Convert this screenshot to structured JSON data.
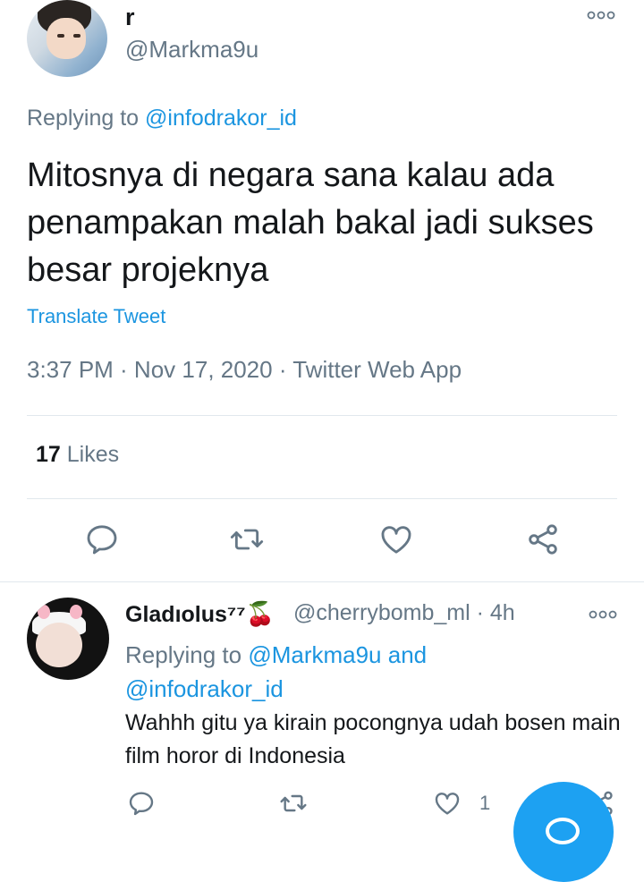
{
  "tweet": {
    "display_name": "r",
    "handle": "@Markma9u",
    "replying_prefix": "Replying to ",
    "replying_to": "@infodrakor_id",
    "text": "Mitosnya di negara sana kalau ada penampakan malah bakal jadi sukses besar projeknya",
    "translate_label": "Translate Tweet",
    "meta": "3:37 PM · Nov 17, 2020 · Twitter Web App",
    "likes_count": "17",
    "likes_label": "Likes"
  },
  "icons": {
    "more": "more-options-icon",
    "reply": "reply-icon",
    "retweet": "retweet-icon",
    "like": "heart-icon",
    "share": "share-icon",
    "compose": "compose-icon"
  },
  "reply": {
    "display_name": "Gladıolus⁷⁷",
    "emoji": "🍒",
    "handle_time": "@cherrybomb_ml · 4h",
    "replying_prefix": "Replying to ",
    "replying_user1": "@Markma9u",
    "replying_and": " and ",
    "replying_user2": "@infodrakor_id",
    "text": "Wahhh gitu ya kirain pocongnya udah bosen main film horor di Indonesia",
    "like_count": "1"
  },
  "colors": {
    "accent": "#1b95e0",
    "muted": "#657786",
    "text": "#14171a",
    "fab": "#1da1f2"
  }
}
